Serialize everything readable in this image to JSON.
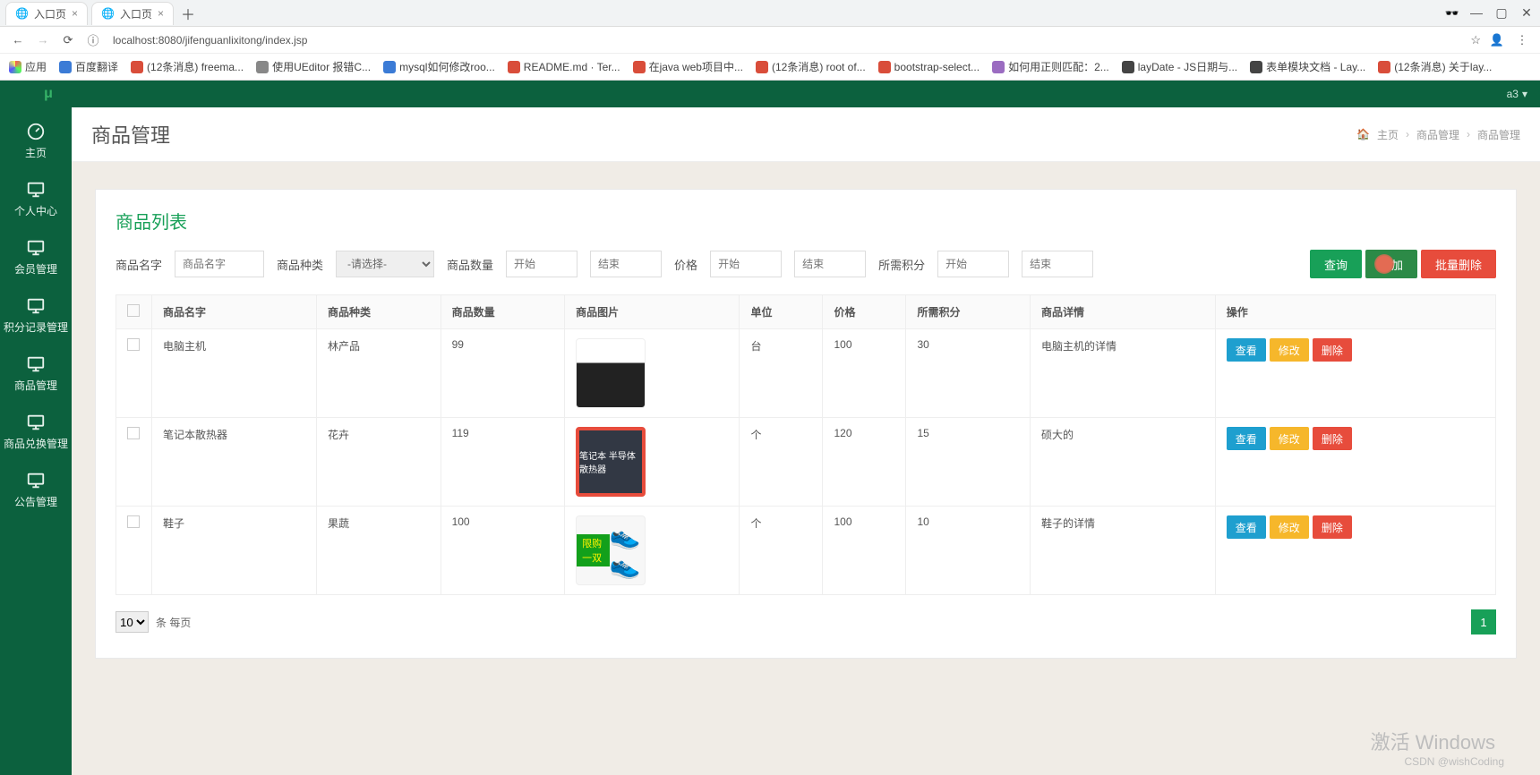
{
  "browser": {
    "tabs": [
      {
        "title": "入口页"
      },
      {
        "title": "入口页"
      }
    ],
    "url": "localhost:8080/jifenguanlixitong/index.jsp",
    "bookmarks": [
      {
        "label": "应用",
        "color": "#f55"
      },
      {
        "label": "百度翻译",
        "color": "#3b7bd6"
      },
      {
        "label": "(12条消息) freema...",
        "color": "#d94d3a"
      },
      {
        "label": "使用UEditor 报错C...",
        "color": "#777"
      },
      {
        "label": "mysql如何修改roo...",
        "color": "#3b7bd6"
      },
      {
        "label": "README.md · Ter...",
        "color": "#d94d3a"
      },
      {
        "label": "在java web项目中...",
        "color": "#d94d3a"
      },
      {
        "label": "(12条消息) root of...",
        "color": "#d94d3a"
      },
      {
        "label": "bootstrap-select...",
        "color": "#d94d3a"
      },
      {
        "label": "如何用正则匹配：2...",
        "color": "#9b6cc1"
      },
      {
        "label": "layDate - JS日期与...",
        "color": "#444"
      },
      {
        "label": "表单模块文档 - Lay...",
        "color": "#444"
      },
      {
        "label": "(12条消息) 关于lay...",
        "color": "#d94d3a"
      }
    ]
  },
  "header": {
    "user": "a3"
  },
  "sidebar": {
    "items": [
      {
        "label": "主页",
        "icon": "gauge"
      },
      {
        "label": "个人中心",
        "icon": "monitor"
      },
      {
        "label": "会员管理",
        "icon": "monitor"
      },
      {
        "label": "积分记录管理",
        "icon": "monitor"
      },
      {
        "label": "商品管理",
        "icon": "monitor"
      },
      {
        "label": "商品兑换管理",
        "icon": "monitor"
      },
      {
        "label": "公告管理",
        "icon": "monitor"
      }
    ]
  },
  "page": {
    "title": "商品管理",
    "breadcrumb": [
      "主页",
      "商品管理",
      "商品管理"
    ]
  },
  "panel": {
    "title": "商品列表",
    "filters": {
      "name_label": "商品名字",
      "name_placeholder": "商品名字",
      "type_label": "商品种类",
      "type_placeholder": "-请选择-",
      "qty_label": "商品数量",
      "start_placeholder": "开始",
      "end_placeholder": "结束",
      "price_label": "价格",
      "points_label": "所需积分"
    },
    "buttons": {
      "query": "查询",
      "add": "添加",
      "bulk_delete": "批量删除"
    },
    "columns": [
      "",
      "商品名字",
      "商品种类",
      "商品数量",
      "商品图片",
      "单位",
      "价格",
      "所需积分",
      "商品详情",
      "操作"
    ],
    "rows": [
      {
        "name": "电脑主机",
        "type": "林产品",
        "qty": "99",
        "img": "pc",
        "unit": "台",
        "price": "100",
        "points": "30",
        "detail": "电脑主机的详情"
      },
      {
        "name": "笔记本散热器",
        "type": "花卉",
        "qty": "119",
        "img": "cooler",
        "img_text": "笔记本 半导体散热器",
        "unit": "个",
        "price": "120",
        "points": "15",
        "detail": "硕大的"
      },
      {
        "name": "鞋子",
        "type": "果蔬",
        "qty": "100",
        "img": "shoe",
        "img_text": "限购一双",
        "unit": "个",
        "price": "100",
        "points": "10",
        "detail": "鞋子的详情"
      }
    ],
    "row_ops": {
      "view": "查看",
      "edit": "修改",
      "del": "删除"
    },
    "pager": {
      "size": "10",
      "size_suffix": "条 每页",
      "page": "1"
    }
  },
  "watermark": {
    "line1": "激活 Windows",
    "line2": "CSDN @wishCoding"
  }
}
